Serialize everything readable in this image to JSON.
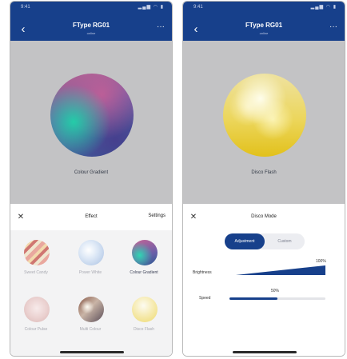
{
  "colors": {
    "header": "#17408b",
    "accent": "#17408b",
    "canvas": "#c3c3c5"
  },
  "left": {
    "status": {
      "time": "9:41",
      "icons": "▂▄▆ ◠ ▮"
    },
    "header": {
      "title": "FType RG01",
      "subtitle": "online",
      "back_icon": "chevron-left-icon",
      "more_icon": "ellipsis-icon"
    },
    "preview": {
      "label": "Colour Gradient"
    },
    "sheet": {
      "close_icon": "close-icon",
      "title": "Effect",
      "settings_label": "Settings",
      "effects": [
        {
          "label": "Sweet Candy"
        },
        {
          "label": "Power White"
        },
        {
          "label": "Colour Gradient",
          "active": true
        },
        {
          "label": "Colour Pulse"
        },
        {
          "label": "Multi Colour"
        },
        {
          "label": "Disco Flash"
        }
      ]
    }
  },
  "right": {
    "status": {
      "time": "9:41",
      "icons": "▂▄▆ ◠ ▮"
    },
    "header": {
      "title": "FType RG01",
      "subtitle": "online",
      "back_icon": "chevron-left-icon",
      "more_icon": "ellipsis-icon"
    },
    "preview": {
      "label": "Disco Flash"
    },
    "sheet": {
      "close_icon": "close-icon",
      "title": "Disco Mode",
      "segments": {
        "first": "Adjustment",
        "second": "Custom",
        "selected": "Adjustment"
      },
      "brightness": {
        "label": "Brightness",
        "value_text": "100%",
        "value": 1.0
      },
      "speed": {
        "label": "Speed",
        "value_text": "50%",
        "value": 0.5
      }
    }
  }
}
